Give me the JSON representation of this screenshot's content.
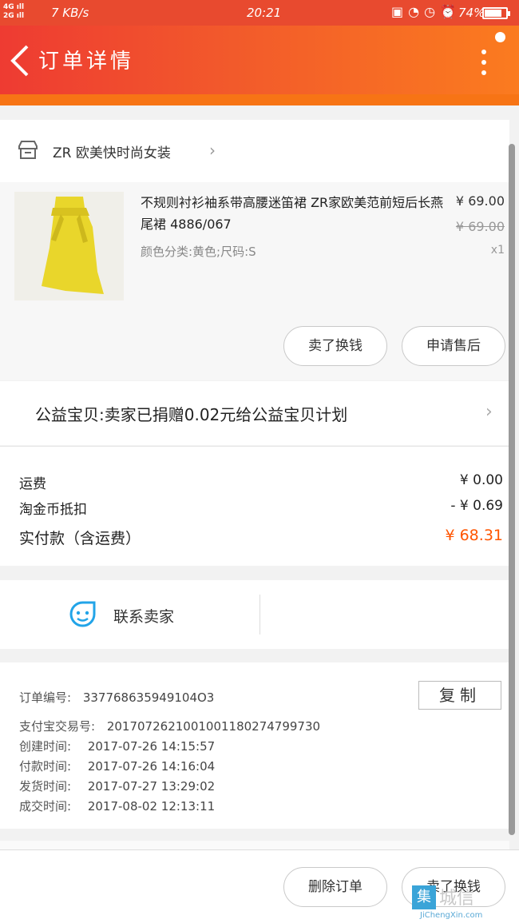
{
  "status_bar": {
    "network": "4G 2G",
    "speed": "7 KB/s",
    "time": "20:21",
    "battery": "74%"
  },
  "header": {
    "title": "订单详情"
  },
  "shop": {
    "name": "ZR 欧美快时尚女装"
  },
  "item": {
    "title": "不规则衬衫袖系带高腰迷笛裙 ZR家欧美范前短后长燕尾裙 4886/067",
    "sku": "颜色分类:黄色;尺码:S",
    "price": "¥ 69.00",
    "original_price": "¥ 69.00",
    "quantity": "x1",
    "buttons": {
      "sell": "卖了换钱",
      "after_sale": "申请售后"
    }
  },
  "charity": {
    "text": "公益宝贝:卖家已捐赠0.02元给公益宝贝计划"
  },
  "fees": {
    "shipping_label": "运费",
    "shipping_value": "¥ 0.00",
    "coin_label": "淘金币抵扣",
    "coin_value": "- ¥ 0.69",
    "paid_label": "实付款（含运费）",
    "paid_value": "¥ 68.31"
  },
  "contact": {
    "label": "联系卖家"
  },
  "order_info": {
    "order_no_label": "订单编号:",
    "order_no": "337768635949104O3",
    "copy_label": "复制",
    "alipay_label": "支付宝交易号:",
    "alipay_no": "2017072621001001180274799730",
    "created_label": "创建时间:",
    "created": "2017-07-26 14:15:57",
    "paid_label": "付款时间:",
    "paid": "2017-07-26 14:16:04",
    "shipped_label": "发货时间:",
    "shipped": "2017-07-27 13:29:02",
    "completed_label": "成交时间:",
    "completed": "2017-08-02 12:13:11"
  },
  "footer": {
    "delete": "删除订单",
    "sell": "卖了换钱"
  },
  "watermark": {
    "text": "城信",
    "url": "JiChengXin.com"
  },
  "colors": {
    "header_start": "#ee3b32",
    "header_end": "#fb7b1f",
    "accent": "#ff5500",
    "product": "#e9d62b"
  }
}
